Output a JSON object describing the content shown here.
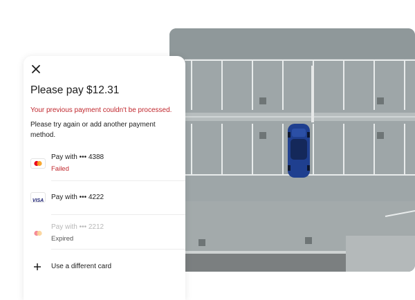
{
  "dialog": {
    "close_icon": "close-icon",
    "title": "Please pay $12.31",
    "error_message": "Your previous payment couldn't be processed.",
    "hint": "Please try again or add another payment method.",
    "payment_methods": [
      {
        "brand": "mastercard",
        "label": "Pay with ••• 4388",
        "status": "Failed",
        "status_color": "#c0272d",
        "enabled": true
      },
      {
        "brand": "visa",
        "label": "Pay with ••• 4222",
        "status": "",
        "enabled": true
      },
      {
        "brand": "mastercard",
        "label": "Pay with ••• 2212",
        "status": "Expired",
        "status_color": "#555555",
        "enabled": false
      }
    ],
    "add_card": {
      "icon": "plus-icon",
      "label": "Use a different card"
    }
  },
  "brand_labels": {
    "visa": "VISA"
  },
  "colors": {
    "error": "#c0272d",
    "car": "#1f3f8f"
  }
}
